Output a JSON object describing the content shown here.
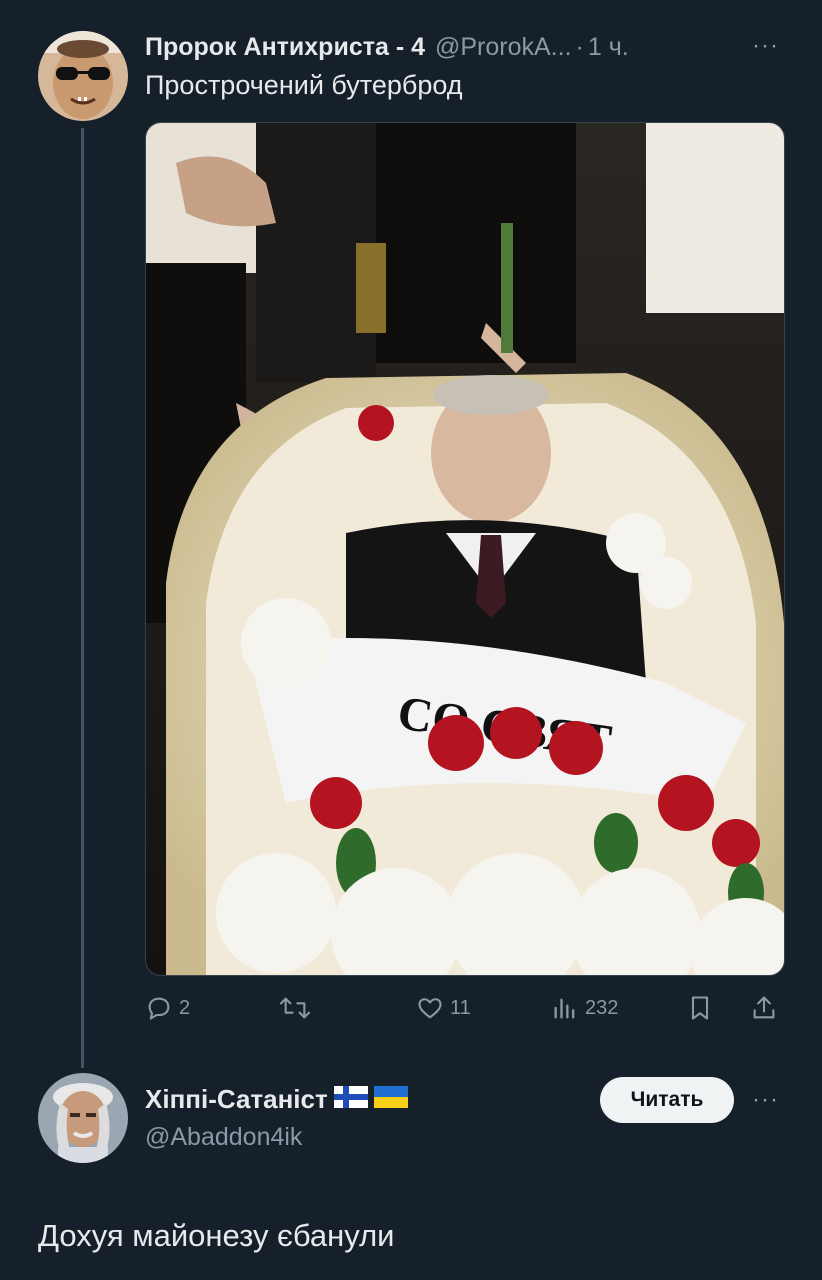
{
  "tweet": {
    "author_name": "Пророк Антихриста - 4",
    "author_handle": "@ProrokA...",
    "separator": "·",
    "time": "1 ч.",
    "more_icon": "···",
    "text": "Прострочений бутерброд",
    "image": {
      "description_icon": "photo",
      "banner_text": "СО СВЯТ"
    },
    "actions": {
      "replies": "2",
      "reposts": "",
      "likes": "11",
      "views": "232"
    }
  },
  "reply_author": {
    "name": "Хіппі-Сатаніст",
    "handle": "@Abaddon4ik",
    "follow_label": "Читать",
    "more_icon": "···",
    "flags": [
      "flag-finland",
      "flag-ukraine"
    ]
  },
  "reply": {
    "text": "Дохуя майонезу єбанули"
  },
  "colors": {
    "background": "#15202b",
    "text": "#e7e9ea",
    "muted": "#8b98a5",
    "follow_bg": "#eff3f4"
  }
}
